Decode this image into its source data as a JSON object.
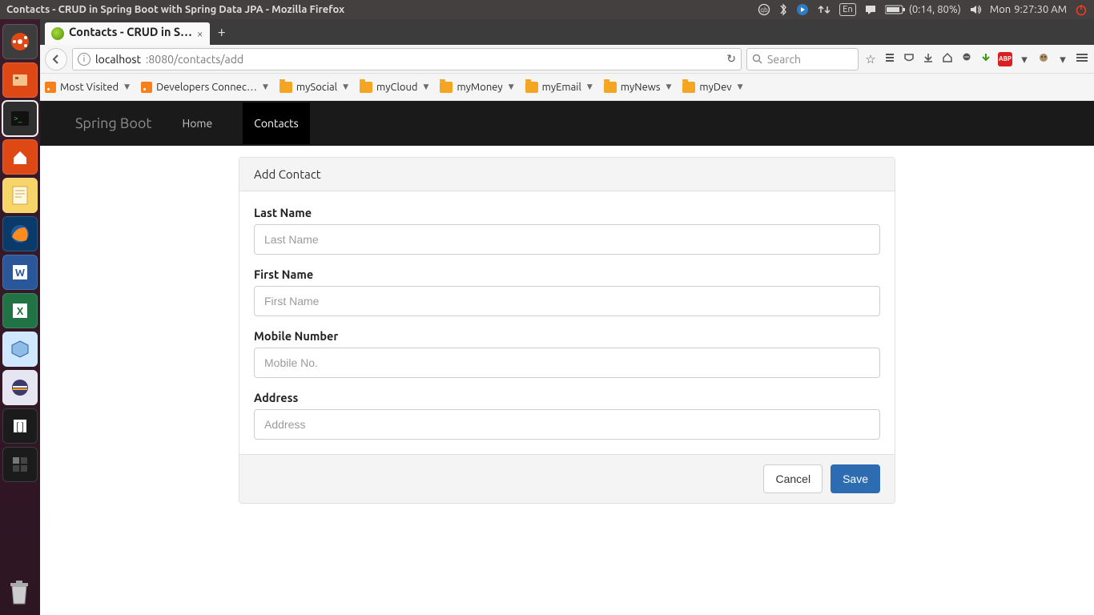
{
  "menubar": {
    "window_title": "Contacts - CRUD in Spring Boot with Spring Data JPA - Mozilla Firefox",
    "keyboard_indicator": "En",
    "battery_text": "(0:14, 80%)",
    "day": "Mon",
    "time": "9:27:30 AM"
  },
  "browser": {
    "tab_title": "Contacts - CRUD in S…",
    "url_host": "localhost",
    "url_port_path": ":8080/contacts/add",
    "search_placeholder": "Search"
  },
  "bookmarks": {
    "most_visited": "Most Visited",
    "dev_connect": "Developers Connec…",
    "my_social": "mySocial",
    "my_cloud": "myCloud",
    "my_money": "myMoney",
    "my_email": "myEmail",
    "my_news": "myNews",
    "my_dev": "myDev"
  },
  "app": {
    "brand": "Spring Boot",
    "nav_home": "Home",
    "nav_contacts": "Contacts",
    "panel_title": "Add Contact",
    "fields": {
      "last_name": {
        "label": "Last Name",
        "placeholder": "Last Name",
        "value": ""
      },
      "first_name": {
        "label": "First Name",
        "placeholder": "First Name",
        "value": ""
      },
      "mobile": {
        "label": "Mobile Number",
        "placeholder": "Mobile No.",
        "value": ""
      },
      "address": {
        "label": "Address",
        "placeholder": "Address",
        "value": ""
      }
    },
    "cancel": "Cancel",
    "save": "Save"
  }
}
